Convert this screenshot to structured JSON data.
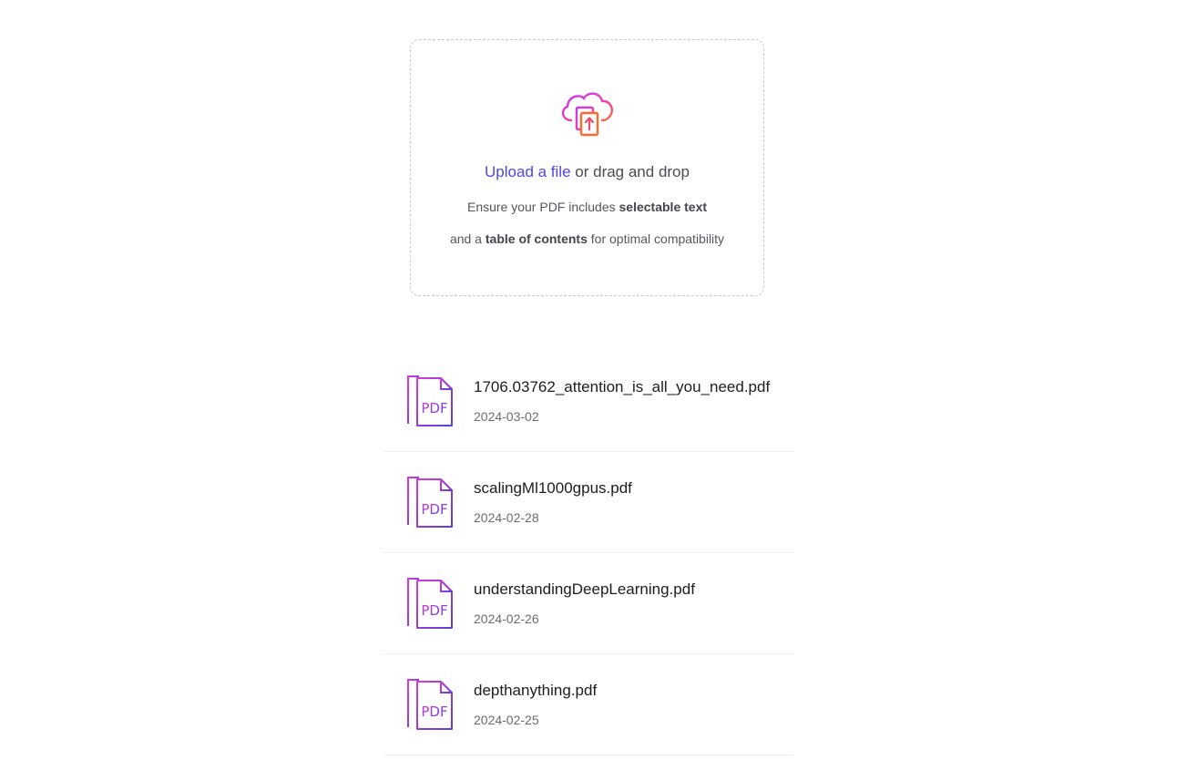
{
  "upload": {
    "link_label": "Upload a file",
    "rest_label": " or drag and drop",
    "hint1_prefix": "Ensure your PDF includes ",
    "hint1_bold": "selectable text",
    "hint2_prefix": "and a ",
    "hint2_bold": "table of contents",
    "hint2_suffix": " for optimal compatibility",
    "icon": "cloud-upload-icon"
  },
  "colors": {
    "accent": "#4f46e5",
    "icon_gradient_start": "#d63ad9",
    "icon_gradient_end": "#5b3fd6",
    "upload_icon_start": "#e040fb",
    "upload_icon_end": "#ff6a2b"
  },
  "files": [
    {
      "name": "1706.03762_attention_is_all_you_need.pdf",
      "date": "2024-03-02",
      "icon_label": "PDF"
    },
    {
      "name": "scalingMl1000gpus.pdf",
      "date": "2024-02-28",
      "icon_label": "PDF"
    },
    {
      "name": "understandingDeepLearning.pdf",
      "date": "2024-02-26",
      "icon_label": "PDF"
    },
    {
      "name": "depthanything.pdf",
      "date": "2024-02-25",
      "icon_label": "PDF"
    }
  ]
}
